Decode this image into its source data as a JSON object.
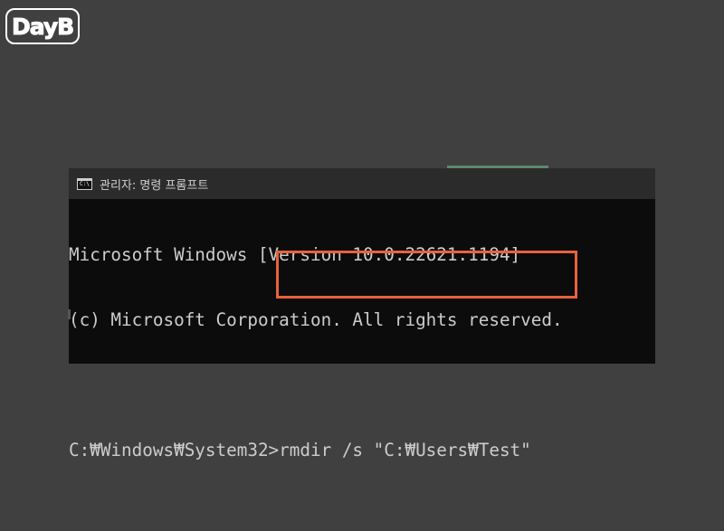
{
  "logo": {
    "text": "DayB"
  },
  "window": {
    "title": "관리자: 명령 프롬프트",
    "icon": "cmd-window-icon",
    "icon_glyph": "C:\\"
  },
  "console": {
    "lines": [
      "Microsoft Windows [Version 10.0.22621.1194]",
      "(c) Microsoft Corporation. All rights reserved.",
      "",
      "C:₩Windows₩System32>rmdir /s \"C:₩Users₩Test\""
    ]
  },
  "colors": {
    "background": "#404040",
    "console_bg": "#0c0c0c",
    "titlebar_bg": "#2b2b2b",
    "console_text": "#cccccc",
    "highlight": "#e8623a"
  }
}
